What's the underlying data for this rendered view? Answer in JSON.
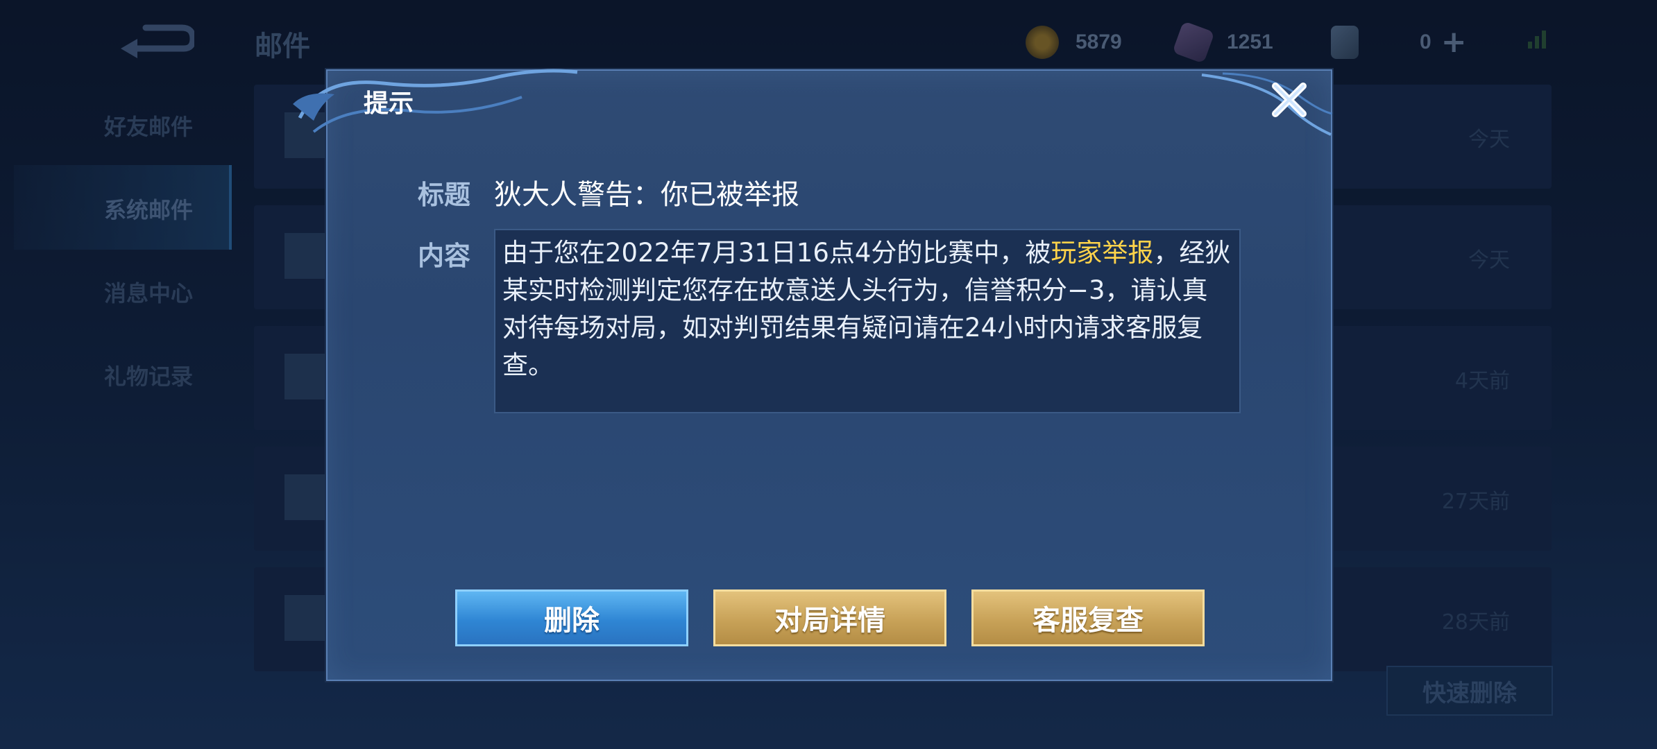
{
  "header": {
    "title": "邮件",
    "currencies": [
      {
        "icon": "gold-coin-icon",
        "value": "5879"
      },
      {
        "icon": "diamond-icon",
        "value": "1251"
      },
      {
        "icon": "voucher-icon",
        "value": "0"
      }
    ],
    "plus_label": "+"
  },
  "sidebar": {
    "items": [
      {
        "label": "好友邮件"
      },
      {
        "label": "系统邮件",
        "active": true
      },
      {
        "label": "消息中心"
      },
      {
        "label": "礼物记录"
      }
    ]
  },
  "mails": [
    {
      "time": "今天"
    },
    {
      "time": "今天"
    },
    {
      "time": "4天前"
    },
    {
      "time": "27天前"
    },
    {
      "time": "28天前"
    }
  ],
  "quick_delete_label": "快速删除",
  "dialog": {
    "title": "提示",
    "subject_label": "标题",
    "subject": "狄大人警告：你已被举报",
    "content_label": "内容",
    "content_before": "由于您在2022年7月31日16点4分的比赛中，被",
    "content_highlight": "玩家举报",
    "content_after": "，经狄某实时检测判定您存在故意送人头行为，信誉积分−3，请认真对待每场对局，如对判罚结果有疑问请在24小时内请求客服复查。",
    "buttons": {
      "delete": "删除",
      "match_details": "对局详情",
      "customer_review": "客服复查"
    }
  },
  "colors": {
    "highlight": "#ffd34a",
    "blue_button": "#2f86d4",
    "gold_button": "#c8a258"
  }
}
